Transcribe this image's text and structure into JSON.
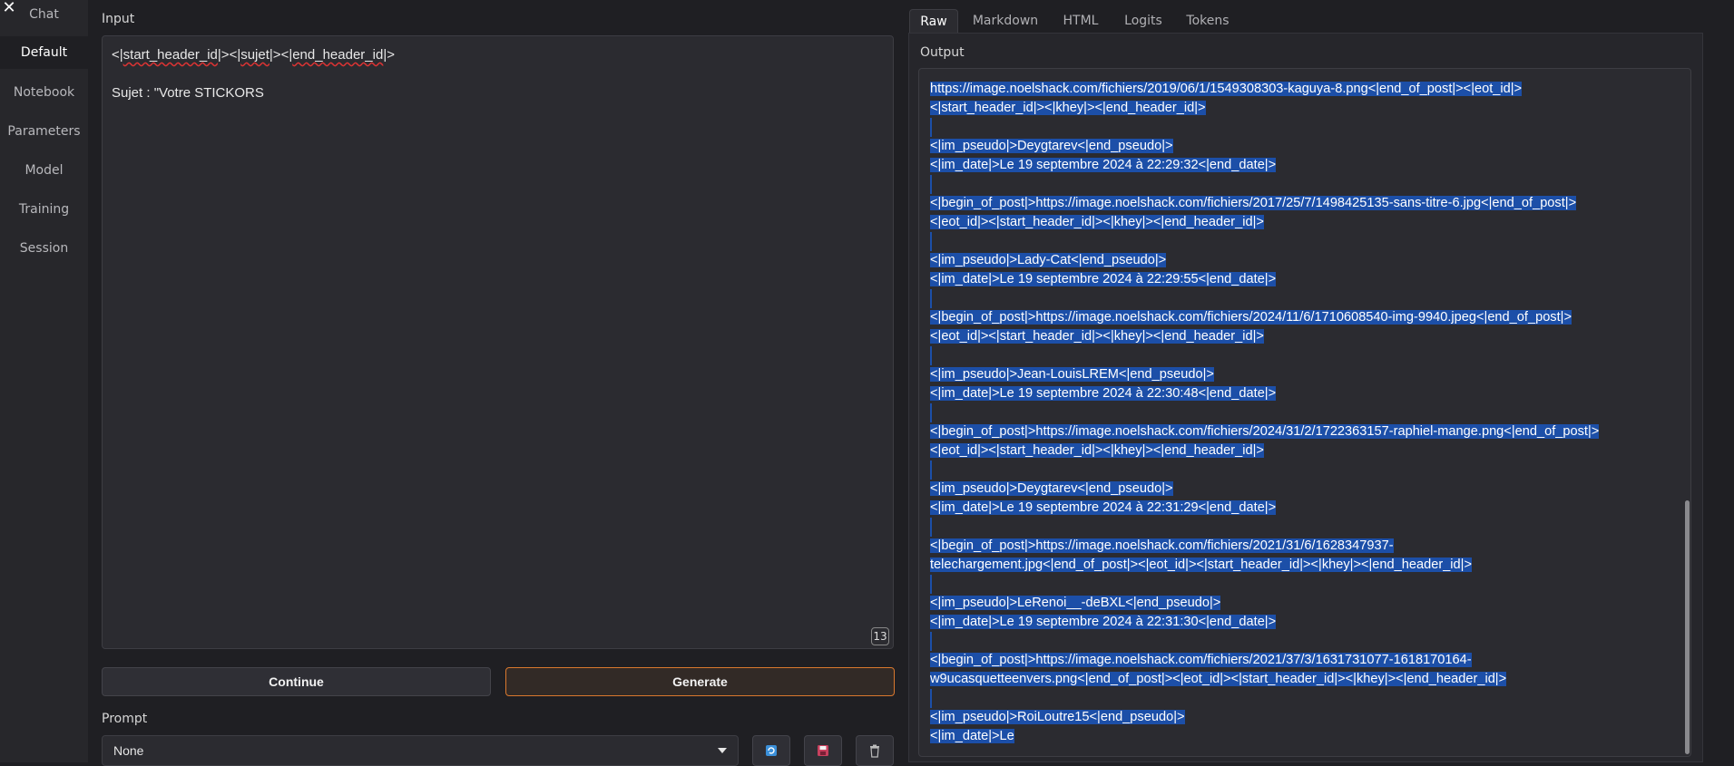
{
  "sidebar": {
    "items": [
      {
        "label": "Chat",
        "active": false
      },
      {
        "label": "Default",
        "active": true
      },
      {
        "label": "Notebook",
        "active": false
      },
      {
        "label": "Parameters",
        "active": false
      },
      {
        "label": "Model",
        "active": false
      },
      {
        "label": "Training",
        "active": false
      },
      {
        "label": "Session",
        "active": false
      }
    ],
    "close_icon": "close-icon"
  },
  "input": {
    "label": "Input",
    "line1": [
      "<|",
      "start_header_id",
      "|><|",
      "sujet",
      "|><|",
      "end_header_id",
      "|>"
    ],
    "line2": "Sujet : \"Votre STICKORS",
    "token_count": "13"
  },
  "buttons": {
    "continue": "Continue",
    "generate": "Generate"
  },
  "prompt": {
    "label": "Prompt",
    "selected": "None"
  },
  "tabs": [
    "Raw",
    "Markdown",
    "HTML",
    "Logits",
    "Tokens"
  ],
  "output": {
    "label": "Output",
    "lines": [
      "https://image.noelshack.com/fichiers/2019/06/1/1549308303-kaguya-8.png<|end_of_post|><|eot_id|>",
      "<|start_header_id|><|khey|><|end_header_id|>",
      "",
      "<|im_pseudo|>Deygtarev<|end_pseudo|>",
      "<|im_date|>Le 19 septembre 2024 à 22:29:32<|end_date|>",
      "",
      "<|begin_of_post|>https://image.noelshack.com/fichiers/2017/25/7/1498425135-sans-titre-6.jpg<|end_of_post|>",
      "<|eot_id|><|start_header_id|><|khey|><|end_header_id|>",
      "",
      "<|im_pseudo|>Lady-Cat<|end_pseudo|>",
      "<|im_date|>Le 19 septembre 2024 à 22:29:55<|end_date|>",
      "",
      "<|begin_of_post|>https://image.noelshack.com/fichiers/2024/11/6/1710608540-img-9940.jpeg<|end_of_post|>",
      "<|eot_id|><|start_header_id|><|khey|><|end_header_id|>",
      "",
      "<|im_pseudo|>Jean-LouisLREM<|end_pseudo|>",
      "<|im_date|>Le 19 septembre 2024 à 22:30:48<|end_date|>",
      "",
      "<|begin_of_post|>https://image.noelshack.com/fichiers/2024/31/2/1722363157-raphiel-mange.png<|end_of_post|>",
      "<|eot_id|><|start_header_id|><|khey|><|end_header_id|>",
      "",
      "<|im_pseudo|>Deygtarev<|end_pseudo|>",
      "<|im_date|>Le 19 septembre 2024 à 22:31:29<|end_date|>",
      "",
      "<|begin_of_post|>https://image.noelshack.com/fichiers/2021/31/6/1628347937-",
      "telechargement.jpg<|end_of_post|><|eot_id|><|start_header_id|><|khey|><|end_header_id|>",
      "",
      "<|im_pseudo|>LeRenoi__-deBXL<|end_pseudo|>",
      "<|im_date|>Le 19 septembre 2024 à 22:31:30<|end_date|>",
      "",
      "<|begin_of_post|>https://image.noelshack.com/fichiers/2021/37/3/1631731077-1618170164-",
      "w9ucasquetteenvers.png<|end_of_post|><|eot_id|><|start_header_id|><|khey|><|end_header_id|>",
      "",
      "<|im_pseudo|>RoiLoutre15<|end_pseudo|>",
      "<|im_date|>Le"
    ]
  },
  "colors": {
    "selection": "#1c4fa8",
    "accent": "#d9782e"
  }
}
